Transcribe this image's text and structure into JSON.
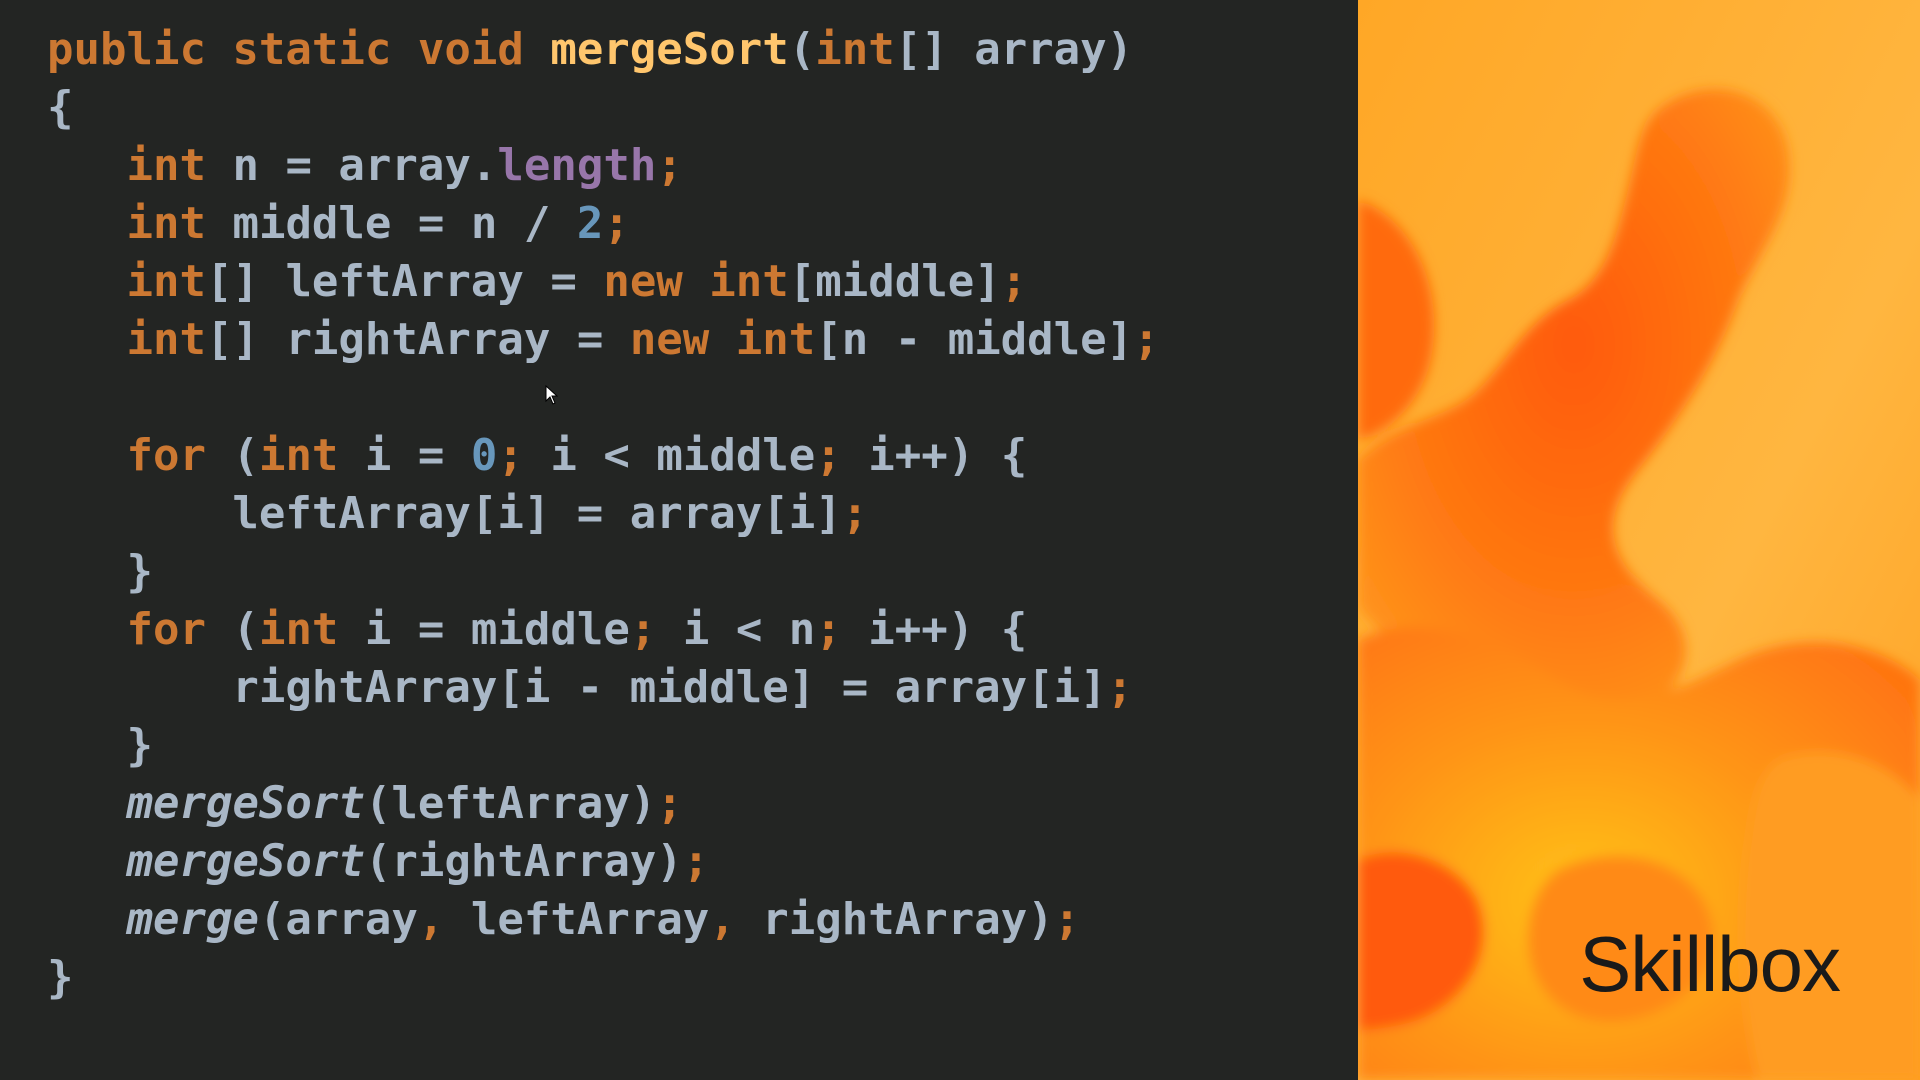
{
  "code": {
    "language": "java",
    "lines": [
      [
        {
          "t": "kw",
          "v": "public static void "
        },
        {
          "t": "fn",
          "v": "mergeSort"
        },
        {
          "t": "plain",
          "v": "("
        },
        {
          "t": "kw",
          "v": "int"
        },
        {
          "t": "plain",
          "v": "[] array)"
        }
      ],
      [
        {
          "t": "plain",
          "v": "{"
        }
      ],
      [
        {
          "t": "plain",
          "v": "   "
        },
        {
          "t": "kw",
          "v": "int"
        },
        {
          "t": "plain",
          "v": " n = array."
        },
        {
          "t": "field",
          "v": "length"
        },
        {
          "t": "punct",
          "v": ";"
        }
      ],
      [
        {
          "t": "plain",
          "v": "   "
        },
        {
          "t": "kw",
          "v": "int"
        },
        {
          "t": "plain",
          "v": " middle = n / "
        },
        {
          "t": "num",
          "v": "2"
        },
        {
          "t": "punct",
          "v": ";"
        }
      ],
      [
        {
          "t": "plain",
          "v": "   "
        },
        {
          "t": "kw",
          "v": "int"
        },
        {
          "t": "plain",
          "v": "[] leftArray = "
        },
        {
          "t": "kw",
          "v": "new int"
        },
        {
          "t": "plain",
          "v": "[middle]"
        },
        {
          "t": "punct",
          "v": ";"
        }
      ],
      [
        {
          "t": "plain",
          "v": "   "
        },
        {
          "t": "kw",
          "v": "int"
        },
        {
          "t": "plain",
          "v": "[] rightArray = "
        },
        {
          "t": "kw",
          "v": "new int"
        },
        {
          "t": "plain",
          "v": "[n - middle]"
        },
        {
          "t": "punct",
          "v": ";"
        }
      ],
      [
        {
          "t": "plain",
          "v": ""
        }
      ],
      [
        {
          "t": "plain",
          "v": "   "
        },
        {
          "t": "kw",
          "v": "for"
        },
        {
          "t": "plain",
          "v": " ("
        },
        {
          "t": "kw",
          "v": "int"
        },
        {
          "t": "plain",
          "v": " i = "
        },
        {
          "t": "num",
          "v": "0"
        },
        {
          "t": "punct",
          "v": ";"
        },
        {
          "t": "plain",
          "v": " i < middle"
        },
        {
          "t": "punct",
          "v": ";"
        },
        {
          "t": "plain",
          "v": " i++) {"
        }
      ],
      [
        {
          "t": "plain",
          "v": "       leftArray[i] = array[i]"
        },
        {
          "t": "punct",
          "v": ";"
        }
      ],
      [
        {
          "t": "plain",
          "v": "   }"
        }
      ],
      [
        {
          "t": "plain",
          "v": "   "
        },
        {
          "t": "kw",
          "v": "for"
        },
        {
          "t": "plain",
          "v": " ("
        },
        {
          "t": "kw",
          "v": "int"
        },
        {
          "t": "plain",
          "v": " i = middle"
        },
        {
          "t": "punct",
          "v": ";"
        },
        {
          "t": "plain",
          "v": " i < n"
        },
        {
          "t": "punct",
          "v": ";"
        },
        {
          "t": "plain",
          "v": " i++) {"
        }
      ],
      [
        {
          "t": "plain",
          "v": "       rightArray[i - middle] = array[i]"
        },
        {
          "t": "punct",
          "v": ";"
        }
      ],
      [
        {
          "t": "plain",
          "v": "   }"
        }
      ],
      [
        {
          "t": "plain",
          "v": "   "
        },
        {
          "t": "call",
          "v": "mergeSort"
        },
        {
          "t": "plain",
          "v": "(leftArray)"
        },
        {
          "t": "punct",
          "v": ";"
        }
      ],
      [
        {
          "t": "plain",
          "v": "   "
        },
        {
          "t": "call",
          "v": "mergeSort"
        },
        {
          "t": "plain",
          "v": "(rightArray)"
        },
        {
          "t": "punct",
          "v": ";"
        }
      ],
      [
        {
          "t": "plain",
          "v": "   "
        },
        {
          "t": "call",
          "v": "merge"
        },
        {
          "t": "plain",
          "v": "(array"
        },
        {
          "t": "punct",
          "v": ","
        },
        {
          "t": "plain",
          "v": " leftArray"
        },
        {
          "t": "punct",
          "v": ","
        },
        {
          "t": "plain",
          "v": " rightArray)"
        },
        {
          "t": "punct",
          "v": ";"
        }
      ],
      [
        {
          "t": "plain",
          "v": "}"
        }
      ]
    ]
  },
  "brand": {
    "logo_text": "Skillbox"
  },
  "colors": {
    "code_background": "#232523",
    "keyword": "#cc7832",
    "function_name": "#ffc66d",
    "identifier": "#a9b7c6",
    "field": "#9876aa",
    "number": "#6897bb",
    "art_base": "#ffac2a",
    "art_blob": "#ff6a10"
  },
  "icons": {
    "cursor": "mouse-pointer-icon"
  }
}
